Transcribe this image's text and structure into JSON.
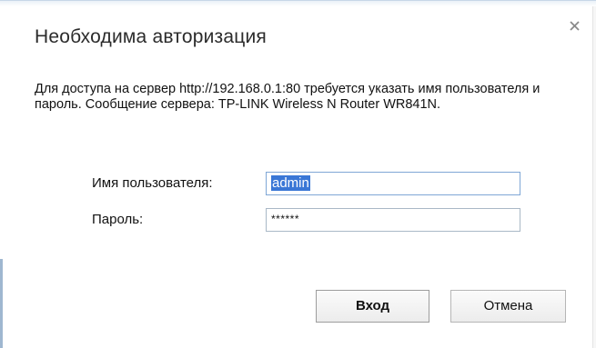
{
  "dialog": {
    "title": "Необходима авторизация",
    "message": "Для доступа на сервер http://192.168.0.1:80 требуется указать имя пользователя и пароль. Сообщение сервера: TP-LINK Wireless N Router WR841N.",
    "close_icon": "close-icon"
  },
  "form": {
    "username_label": "Имя пользователя:",
    "username_value": "admin",
    "password_label": "Пароль:",
    "password_value": "******"
  },
  "buttons": {
    "login_label": "Вход",
    "cancel_label": "Отмена"
  },
  "colors": {
    "selection": "#3a77d6",
    "focus_border": "#7fa7d6"
  }
}
